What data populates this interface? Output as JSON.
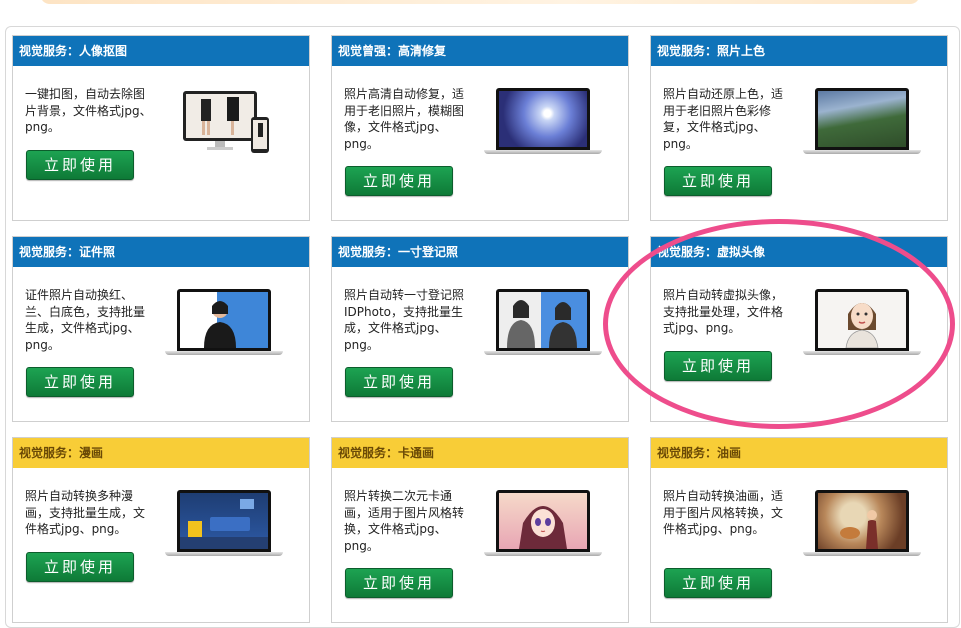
{
  "cards": [
    {
      "title": "视觉服务：人像抠图",
      "desc": "一键扣图，自动去除图片背景，文件格式jpg、png。",
      "button": "立即使用",
      "theme": "blue",
      "icon": "portrait-cutout-device-icon"
    },
    {
      "title": "视觉曾强：高清修复",
      "desc": "照片高清自动修复，适用于老旧照片，模糊图像，文件格式jpg、png。",
      "button": "立即使用",
      "theme": "blue",
      "icon": "hd-restore-laptop-icon"
    },
    {
      "title": "视觉服务：照片上色",
      "desc": "照片自动还原上色，适用于老旧照片色彩修复，文件格式jpg、png。",
      "button": "立即使用",
      "theme": "blue",
      "icon": "colorize-laptop-icon"
    },
    {
      "title": "视觉服务：证件照",
      "desc": "证件照片自动换红、兰、白底色，支持批量生成，文件格式jpg、png。",
      "button": "立即使用",
      "theme": "blue",
      "icon": "id-photo-laptop-icon"
    },
    {
      "title": "视觉服务：一寸登记照",
      "desc": "照片自动转一寸登记照IDPhoto，支持批量生成，文件格式jpg、png。",
      "button": "立即使用",
      "theme": "blue",
      "icon": "one-inch-photo-laptop-icon"
    },
    {
      "title": "视觉服务：虚拟头像",
      "desc": "照片自动转虚拟头像，支持批量处理，文件格式jpg、png。",
      "button": "立即使用",
      "theme": "blue",
      "icon": "virtual-avatar-laptop-icon"
    },
    {
      "title": "视觉服务：漫画",
      "desc": "照片自动转换多种漫画，支持批量生成，文件格式jpg、png。",
      "button": "立即使用",
      "theme": "yellow",
      "icon": "comic-laptop-icon"
    },
    {
      "title": "视觉服务：卡通画",
      "desc": "照片转换二次元卡通画，适用于图片风格转换，文件格式jpg、png。",
      "button": "立即使用",
      "theme": "yellow",
      "icon": "cartoon-laptop-icon"
    },
    {
      "title": "视觉服务：油画",
      "desc": "照片自动转换油画，适用于图片风格转换，文件格式jpg、png。",
      "button": "立即使用",
      "theme": "yellow",
      "icon": "oil-painting-laptop-icon"
    }
  ],
  "colors": {
    "header_blue": "#0f73b9",
    "header_yellow": "#f8cd37",
    "button_green": "#0e7a37",
    "highlight_ring": "#ee4d8c"
  }
}
